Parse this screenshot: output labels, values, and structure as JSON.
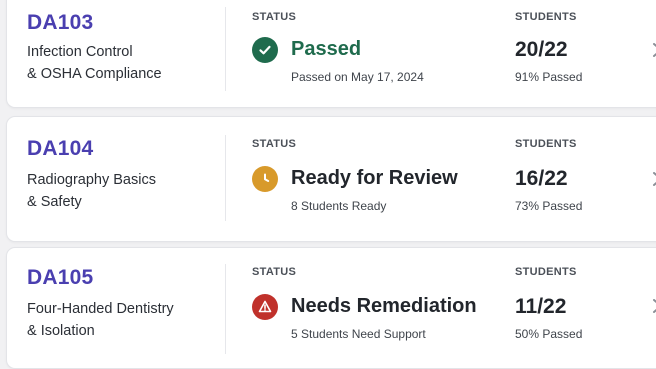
{
  "courses": [
    {
      "code": "DA103",
      "title_line1": "Infection Control",
      "title_line2": "& OSHA Compliance",
      "status_label": "STATUS",
      "status": "Passed",
      "status_detail": "Passed on May 17, 2024",
      "status_color": "#1f6b4d",
      "status_icon": "check-circle-icon",
      "students_label": "STUDENTS",
      "students": "20/22",
      "students_pct": "91% Passed"
    },
    {
      "code": "DA104",
      "title_line1": "Radiography Basics",
      "title_line2": "& Safety",
      "status_label": "STATUS",
      "status": "Ready for Review",
      "status_detail": "8 Students Ready",
      "status_color": "#d89a2b",
      "status_icon": "clock-icon",
      "students_label": "STUDENTS",
      "students": "16/22",
      "students_pct": "73% Passed"
    },
    {
      "code": "DA105",
      "title_line1": "Four-Handed Dentistry",
      "title_line2": "& Isolation",
      "status_label": "STATUS",
      "status": "Needs Remediation",
      "status_detail": "5 Students Need Support",
      "status_color": "#c0312b",
      "status_icon": "alert-icon",
      "students_label": "STUDENTS",
      "students": "11/22",
      "students_pct": "50% Passed"
    }
  ],
  "colors": {
    "course_code": "#4a3fb0",
    "passed": "#1f6b4d",
    "review": "#d89a2b",
    "remediation": "#c0312b"
  }
}
